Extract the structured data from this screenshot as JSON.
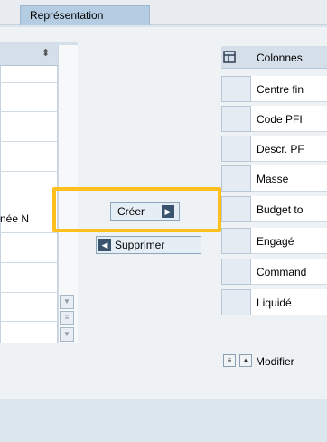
{
  "tabs": [
    {
      "label": "Représentation"
    }
  ],
  "left_panel": {
    "visible_cell": "née N",
    "scroll_icons": [
      "sort-up-down-icon",
      "scroll-up-icon",
      "scroll-down-icon",
      "scroll-bottom-icon"
    ]
  },
  "middle": {
    "create_label": "Créer",
    "delete_label": "Supprimer"
  },
  "right_panel": {
    "header": "Colonnes",
    "rows": [
      "Centre fin",
      "Code PFI",
      "Descr. PF",
      "Masse",
      "Budget to",
      "Engagé",
      "Command",
      "Liquidé"
    ],
    "bottom_action": "Modifier"
  },
  "colors": {
    "highlight": "#ffbf1c",
    "tab_active": "#b5cde2"
  }
}
